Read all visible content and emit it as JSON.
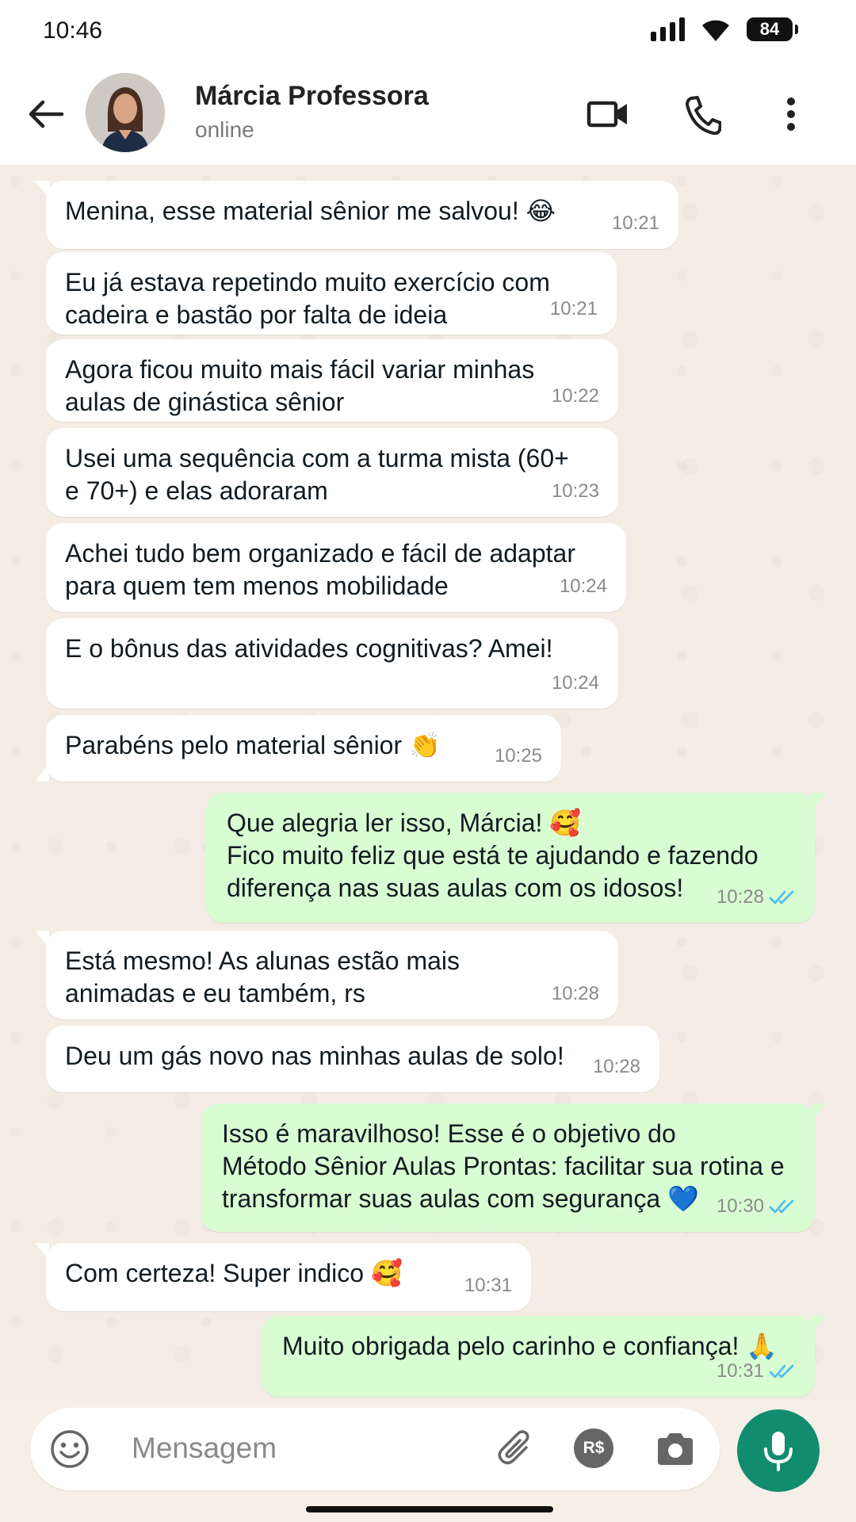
{
  "status_bar": {
    "time": "10:46",
    "battery": "84"
  },
  "contact": {
    "name": "Márcia Professora",
    "status": "online"
  },
  "messages": [
    {
      "dir": "in",
      "text": "Menina, esse material sênior me salvou! 😂",
      "time": "10:21"
    },
    {
      "dir": "in",
      "text": "Eu já estava repetindo muito exercício com\ncadeira e bastão por falta de ideia",
      "time": "10:21"
    },
    {
      "dir": "in",
      "text": "Agora ficou muito mais fácil variar minhas\naulas de ginástica sênior",
      "time": "10:22"
    },
    {
      "dir": "in",
      "text": "Usei uma sequência com a turma mista (60+\ne 70+) e elas adoraram",
      "time": "10:23"
    },
    {
      "dir": "in",
      "text": "Achei tudo bem organizado e fácil de adaptar\npara quem tem menos mobilidade",
      "time": "10:24"
    },
    {
      "dir": "in",
      "text": "E o bônus das atividades cognitivas? Amei!",
      "time": "10:24"
    },
    {
      "dir": "in",
      "text": "Parabéns pelo material sênior 👏",
      "time": "10:25"
    },
    {
      "dir": "out",
      "text": "Que alegria ler isso, Márcia! 🥰\nFico muito feliz que está te ajudando e fazendo\ndiferença nas suas aulas com os idosos!",
      "time": "10:28",
      "read": true
    },
    {
      "dir": "in",
      "text": "Está mesmo! As alunas estão mais\nanimadas e eu também, rs",
      "time": "10:28"
    },
    {
      "dir": "in",
      "text": "Deu um gás novo nas minhas aulas de solo!",
      "time": "10:28"
    },
    {
      "dir": "out",
      "text": "Isso é maravilhoso! Esse é o objetivo do\nMétodo Sênior Aulas Prontas: facilitar sua rotina e\ntransformar suas aulas com segurança 💙",
      "time": "10:30",
      "read": true
    },
    {
      "dir": "in",
      "text": "Com certeza! Super indico 🥰",
      "time": "10:31"
    },
    {
      "dir": "out",
      "text": "Muito obrigada pelo carinho e confiança! 🙏",
      "time": "10:31",
      "read": true
    }
  ],
  "input": {
    "placeholder": "Mensagem",
    "currency_label": "R$"
  },
  "icons": {
    "header": [
      "back-arrow-icon",
      "video-call-icon",
      "phone-icon",
      "more-vert-icon"
    ],
    "input": [
      "emoji-icon",
      "attach-icon",
      "payment-icon",
      "camera-icon",
      "mic-icon"
    ]
  },
  "colors": {
    "incoming": "#ffffff",
    "outgoing": "#d9fdd3",
    "accent": "#128c6e",
    "read_tick": "#53bdeb"
  }
}
